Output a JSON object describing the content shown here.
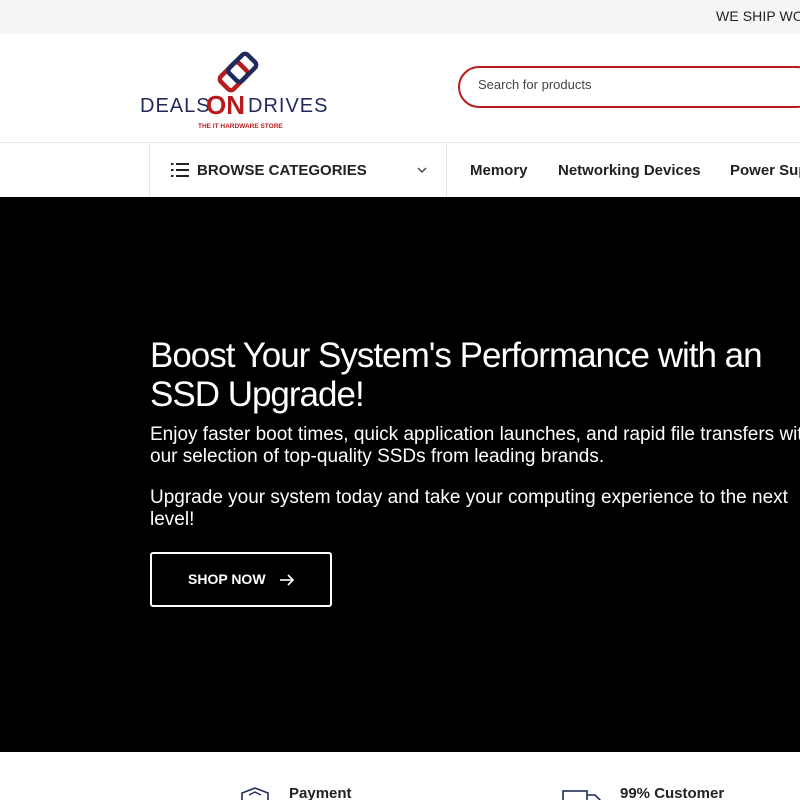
{
  "topbar": {
    "shipping_text": "WE SHIP WORLDWIDE"
  },
  "brand": {
    "name": "DEALSONDRIVES",
    "tagline": "THE IT HARDWARE STORE",
    "primary_color": "#b81b1b",
    "secondary_color": "#1f2a5a"
  },
  "search": {
    "placeholder": "Search for products",
    "value": ""
  },
  "nav": {
    "browse_label": "BROWSE CATEGORIES",
    "links": [
      "Memory",
      "Networking Devices",
      "Power Supply"
    ]
  },
  "hero": {
    "title": "Boost Your System's Performance with an SSD Upgrade!",
    "paragraph1": "Enjoy faster boot times, quick application launches, and rapid file transfers with our selection of top-quality SSDs from leading brands.",
    "paragraph2": "Upgrade your system today and take your computing experience to the next level!",
    "cta_label": "SHOP NOW",
    "background": "#000000"
  },
  "features": [
    {
      "label": "Payment",
      "icon": "payment-shield-icon"
    },
    {
      "label": "99% Customer",
      "icon": "delivery-truck-icon"
    }
  ]
}
